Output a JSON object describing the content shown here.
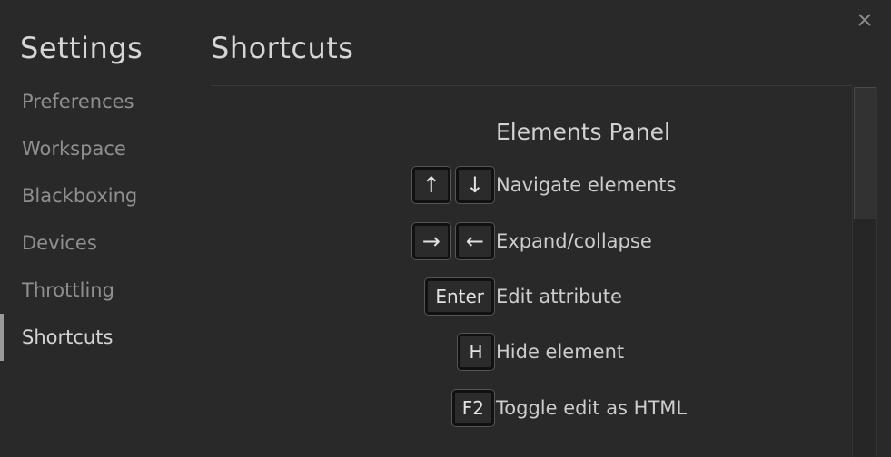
{
  "sidebar": {
    "title": "Settings",
    "items": [
      {
        "label": "Preferences"
      },
      {
        "label": "Workspace"
      },
      {
        "label": "Blackboxing"
      },
      {
        "label": "Devices"
      },
      {
        "label": "Throttling"
      },
      {
        "label": "Shortcuts"
      }
    ],
    "active": "Shortcuts"
  },
  "main": {
    "title": "Shortcuts",
    "section": {
      "title": "Elements Panel",
      "shortcuts": [
        {
          "keys": [
            "↑",
            "↓"
          ],
          "description": "Navigate elements"
        },
        {
          "keys": [
            "→",
            "←"
          ],
          "description": "Expand/collapse"
        },
        {
          "keys": [
            "Enter"
          ],
          "description": "Edit attribute"
        },
        {
          "keys": [
            "H"
          ],
          "description": "Hide element"
        },
        {
          "keys": [
            "F2"
          ],
          "description": "Toggle edit as HTML"
        }
      ]
    }
  },
  "icons": {
    "close": "close-icon"
  },
  "colors": {
    "background": "#292929",
    "active_indicator": "#9a9a9a",
    "key_border": "#111111"
  }
}
